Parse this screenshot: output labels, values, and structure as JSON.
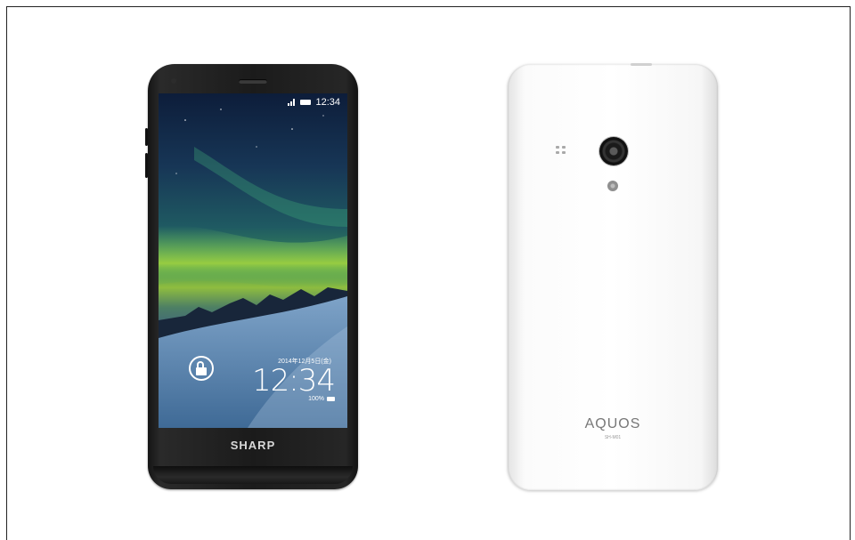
{
  "front": {
    "brand": "SHARP",
    "status_time": "12:34",
    "lock_date": "2014年12月5日(金)",
    "lock_time": "12:34",
    "battery_text": "100%"
  },
  "back": {
    "logo": "AQUOS",
    "model": "SH-M01"
  }
}
